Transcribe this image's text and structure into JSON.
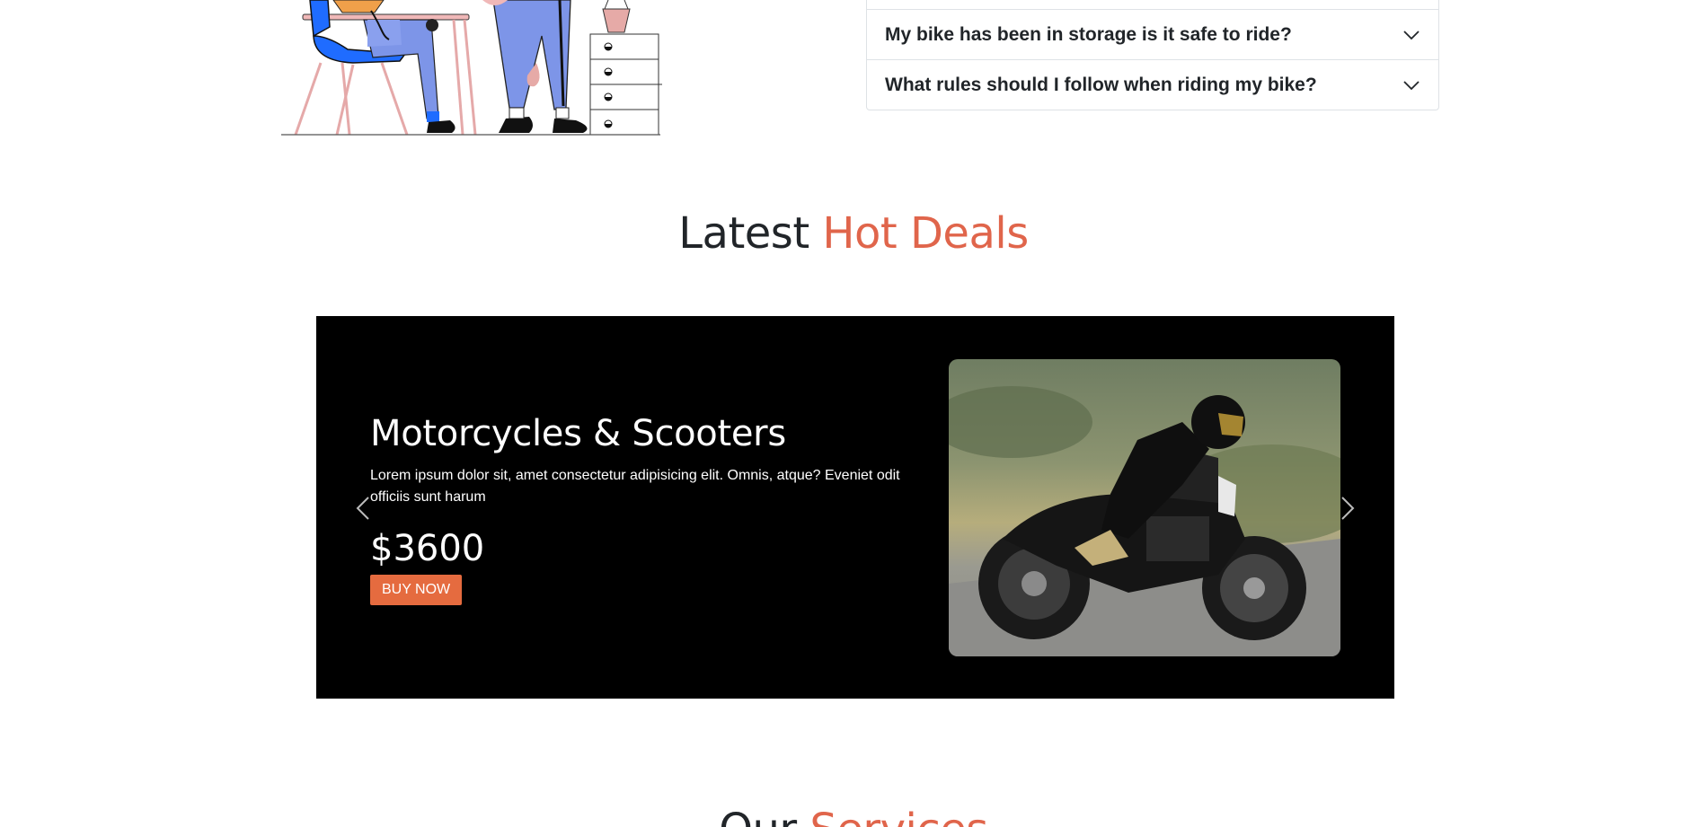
{
  "faq": {
    "items": [
      {
        "question": "My bike has been in storage is it safe to ride?"
      },
      {
        "question": "What rules should I follow when riding my bike?"
      }
    ]
  },
  "deals": {
    "title_plain": "Latest",
    "title_accent": "Hot Deals"
  },
  "slide": {
    "title": "Motorcycles & Scooters",
    "description": "Lorem ipsum dolor sit, amet consectetur adipisicing elit. Omnis, atque? Eveniet odit officiis sunt harum",
    "price": "$3600",
    "button_label": "BUY NOW"
  },
  "services": {
    "title_plain": "Our",
    "title_accent": "Services"
  },
  "colors": {
    "accent": "#e0654b",
    "button": "#e56b3f",
    "carousel_bg": "#000000"
  },
  "icons": {
    "accordion_toggle": "chevron-down-icon",
    "carousel_prev": "chevron-left-icon",
    "carousel_next": "chevron-right-icon"
  }
}
